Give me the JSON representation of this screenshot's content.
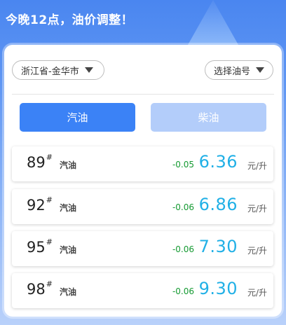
{
  "header": {
    "title": "今晚12点，油价调整！"
  },
  "filters": {
    "region": "浙江省-金华市",
    "fuel_type": "选择油号"
  },
  "tabs": [
    {
      "label": "汽油",
      "active": true
    },
    {
      "label": "柴油",
      "active": false
    }
  ],
  "prices": [
    {
      "grade": "89",
      "mark": "#",
      "kind": "汽油",
      "change": "-0.05",
      "price": "6.36",
      "unit": "元/升"
    },
    {
      "grade": "92",
      "mark": "#",
      "kind": "汽油",
      "change": "-0.06",
      "price": "6.86",
      "unit": "元/升"
    },
    {
      "grade": "95",
      "mark": "#",
      "kind": "汽油",
      "change": "-0.06",
      "price": "7.30",
      "unit": "元/升"
    },
    {
      "grade": "98",
      "mark": "#",
      "kind": "汽油",
      "change": "-0.06",
      "price": "9.30",
      "unit": "元/升"
    }
  ],
  "colors": {
    "accent": "#3b82f6",
    "accent_disabled": "#b3cdfa",
    "price": "#21b0e6",
    "change_down": "#159a32"
  }
}
